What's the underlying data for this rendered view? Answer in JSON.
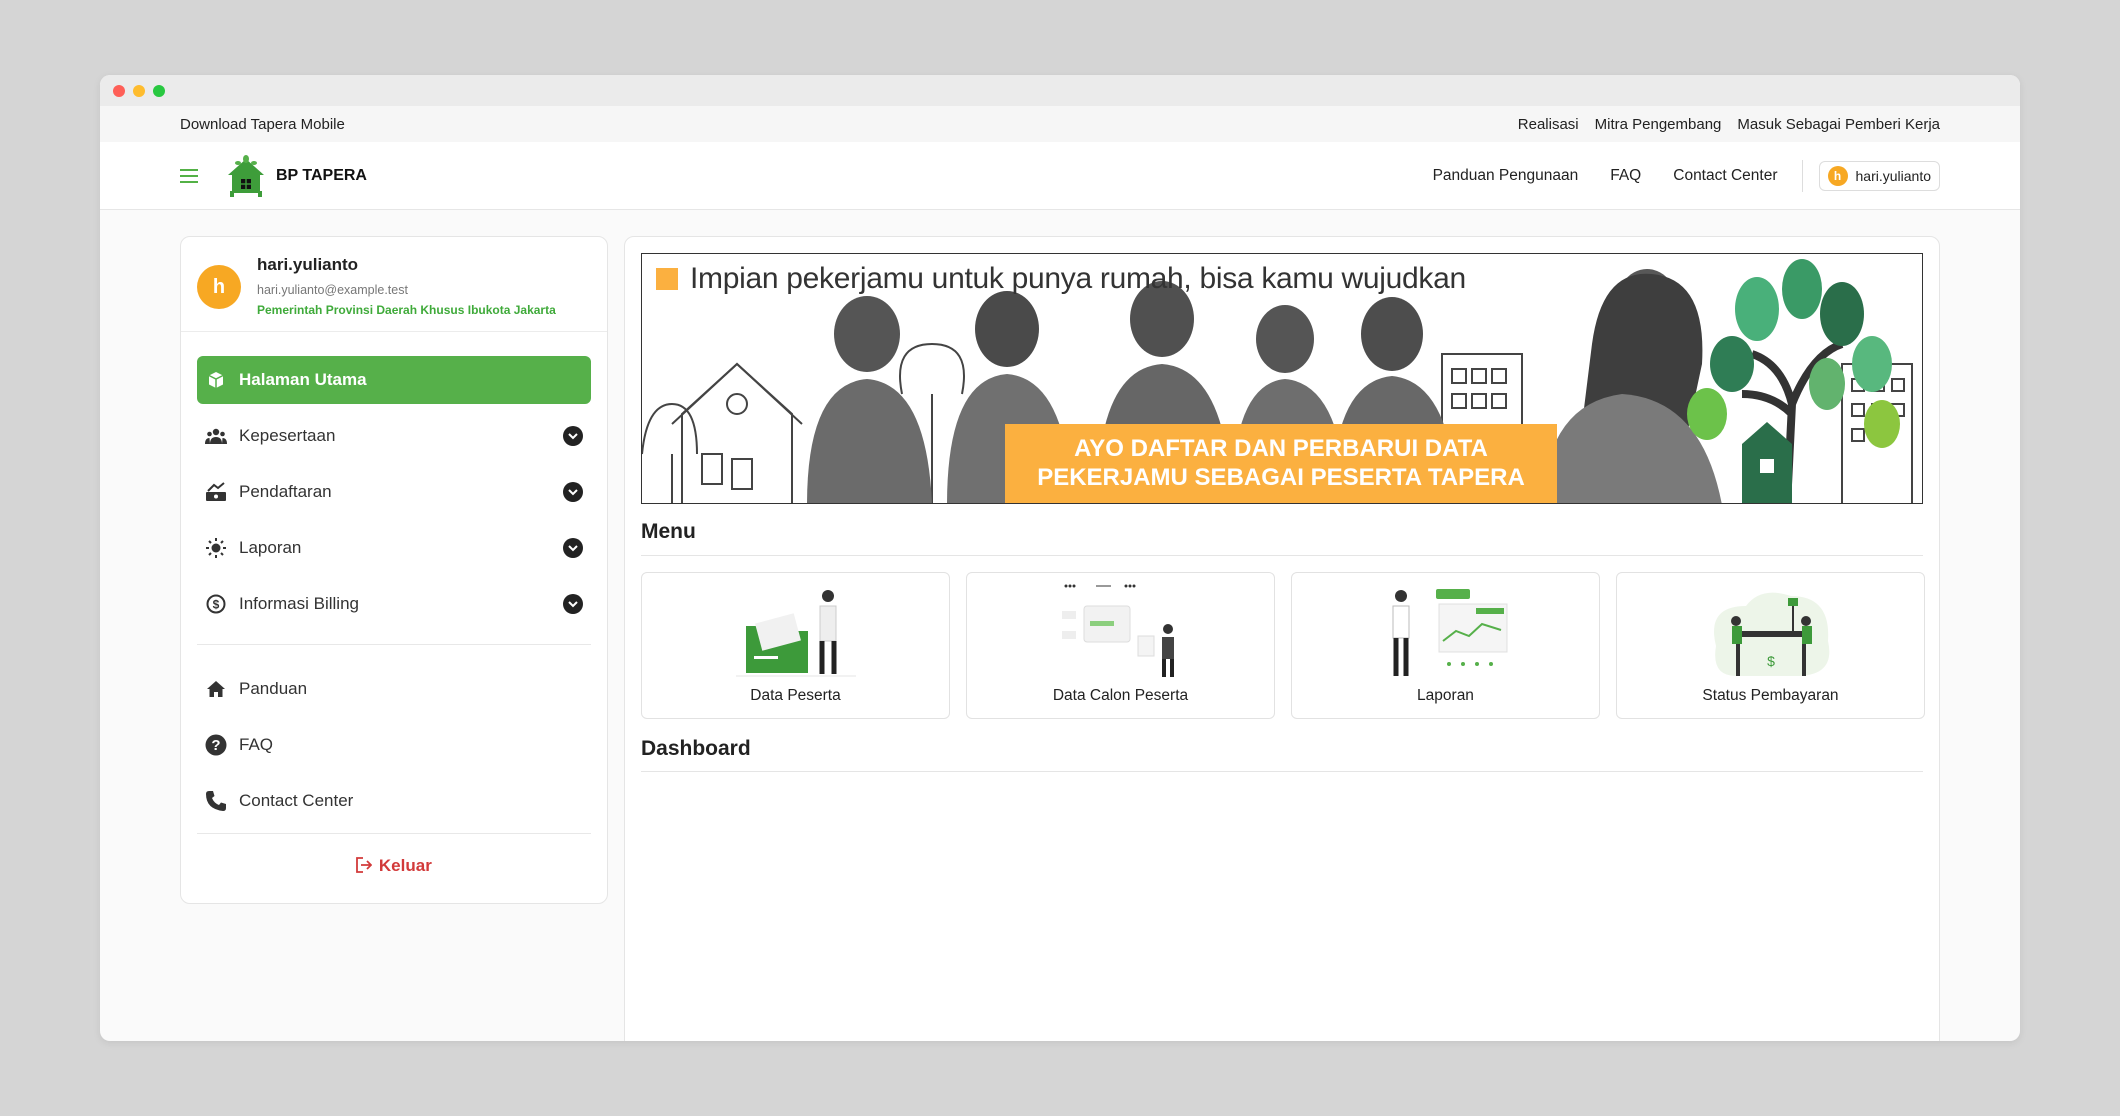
{
  "topbar": {
    "download": "Download Tapera Mobile",
    "links": [
      "Realisasi",
      "Mitra Pengembang",
      "Masuk Sebagai Pemberi Kerja"
    ]
  },
  "navbar": {
    "logo_text": "BP TAPERA",
    "links": [
      "Panduan Pengunaan",
      "FAQ",
      "Contact Center"
    ],
    "user": {
      "initial": "h",
      "name": "hari.yulianto"
    }
  },
  "profile": {
    "initial": "h",
    "name": "hari.yulianto",
    "email": "hari.yulianto@example.test",
    "organization": "Pemerintah Provinsi Daerah Khusus Ibukota Jakarta"
  },
  "sidebar": {
    "items": [
      {
        "label": "Halaman Utama",
        "icon": "box-icon"
      },
      {
        "label": "Kepesertaan",
        "icon": "users-icon"
      },
      {
        "label": "Pendaftaran",
        "icon": "register-icon"
      },
      {
        "label": "Laporan",
        "icon": "report-icon"
      },
      {
        "label": "Informasi Billing",
        "icon": "dollar-icon"
      }
    ],
    "secondary": [
      {
        "label": "Panduan",
        "icon": "home-icon"
      },
      {
        "label": "FAQ",
        "icon": "question-icon"
      },
      {
        "label": "Contact Center",
        "icon": "phone-icon"
      }
    ],
    "logout": "Keluar"
  },
  "banner": {
    "headline": "Impian pekerjamu untuk punya rumah, bisa kamu wujudkan",
    "cta_line1": "AYO DAFTAR DAN PERBARUI DATA",
    "cta_line2": "PEKERJAMU SEBAGAI PESERTA TAPERA"
  },
  "menu": {
    "title": "Menu",
    "cards": [
      "Data Peserta",
      "Data Calon Peserta",
      "Laporan",
      "Status Pembayaran"
    ]
  },
  "dashboard": {
    "title": "Dashboard"
  },
  "colors": {
    "accent": "#56b04a",
    "avatar": "#f7a823",
    "danger": "#d23a3a",
    "banner_orange": "#fbb040"
  }
}
